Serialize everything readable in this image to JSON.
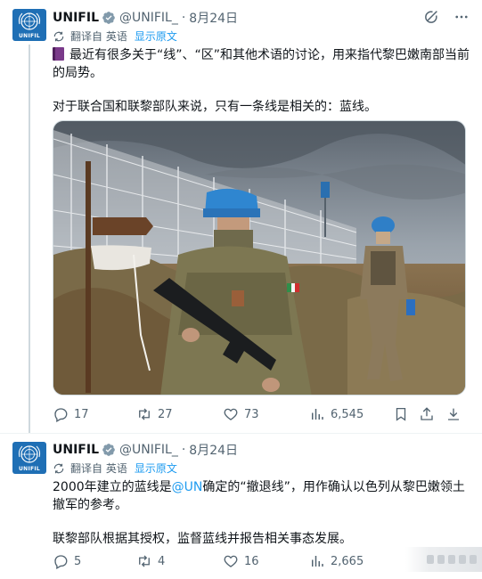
{
  "tweets": [
    {
      "display_name": "UNIFIL",
      "handle": "@UNIFIL_",
      "separator": "·",
      "date": "8月24日",
      "avatar_text": "UNIFIL",
      "translate": {
        "label": "翻译自 英语",
        "show_original": "显示原文"
      },
      "paragraphs": [
        "最近有很多关于“线”、“区”和其他术语的讨论，用来指代黎巴嫩南部当前的局势。",
        "对于联合国和联黎部队来说，只有一条线是相关的：蓝线。"
      ],
      "media": {
        "icon": "photo"
      },
      "stats": {
        "replies": "17",
        "reposts": "27",
        "likes": "73",
        "views": "6,545"
      }
    },
    {
      "display_name": "UNIFIL",
      "handle": "@UNIFIL_",
      "separator": "·",
      "date": "8月24日",
      "avatar_text": "UNIFIL",
      "translate": {
        "label": "翻译自 英语",
        "show_original": "显示原文"
      },
      "paragraph1_before": "2000年建立的蓝线是",
      "paragraph1_mention": "@UN",
      "paragraph1_after": "确定的“撤退线”，用作确认以色列从黎巴嫩领土撤军的参考。",
      "paragraph2": "联黎部队根据其授权，监督蓝线并报告相关事态发展。",
      "stats": {
        "replies": "5",
        "reposts": "4",
        "likes": "16",
        "views": "2,665"
      }
    }
  ],
  "colors": {
    "accent": "#1d9bf0",
    "text": "#0f1419",
    "secondary": "#536471",
    "avatar_bg": "#1f6fb5"
  },
  "icons": {
    "verified": "verified-badge-icon",
    "grok": "grok-icon",
    "more": "more-icon",
    "translate": "translate-icon",
    "reply": "reply-icon",
    "repost": "repost-icon",
    "like": "like-icon",
    "views": "views-icon",
    "bookmark": "bookmark-icon",
    "share": "share-icon",
    "download": "download-icon"
  }
}
